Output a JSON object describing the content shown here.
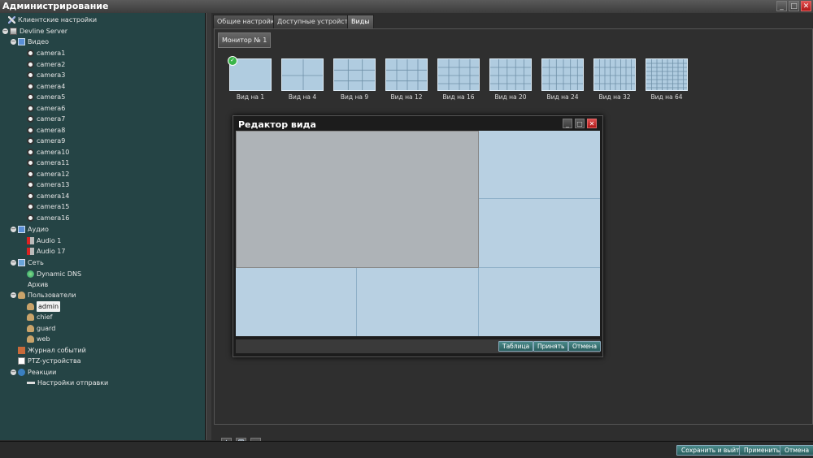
{
  "window": {
    "title": "Администрирование"
  },
  "tree": {
    "client_settings": "Клиентские настройки",
    "server": "Devline Server",
    "video": "Видео",
    "cameras": [
      "camera1",
      "camera2",
      "camera3",
      "camera4",
      "camera5",
      "camera6",
      "camera7",
      "camera8",
      "camera9",
      "camera10",
      "camera11",
      "camera12",
      "camera13",
      "camera14",
      "camera15",
      "camera16"
    ],
    "audio": "Аудио",
    "audio_items": [
      "Audio 1",
      "Audio 17"
    ],
    "network": "Сеть",
    "dns": "Dynamic DNS",
    "archive": "Архив",
    "users": "Пользователи",
    "user_items": [
      "admin",
      "chief",
      "guard",
      "web"
    ],
    "selected_user": "admin",
    "event_log": "Журнал событий",
    "ptz": "PTZ-устройства",
    "reactions": "Реакции",
    "send_settings": "Настройки отправки"
  },
  "tabs": [
    {
      "label": "Общие настройки",
      "active": false
    },
    {
      "label": "Доступные устройства",
      "active": false
    },
    {
      "label": "Виды",
      "active": true
    }
  ],
  "monitor_tab": "Монитор № 1",
  "presets": [
    {
      "label": "Вид на 1",
      "cols": 1,
      "rows": 1,
      "checked": true
    },
    {
      "label": "Вид на 4",
      "cols": 2,
      "rows": 2
    },
    {
      "label": "Вид на 9",
      "cols": 3,
      "rows": 3
    },
    {
      "label": "Вид на 12",
      "cols": 4,
      "rows": 3
    },
    {
      "label": "Вид на 16",
      "cols": 4,
      "rows": 4
    },
    {
      "label": "Вид на 20",
      "cols": 5,
      "rows": 4
    },
    {
      "label": "Вид на 24",
      "cols": 6,
      "rows": 4
    },
    {
      "label": "Вид на 32",
      "cols": 8,
      "rows": 4
    },
    {
      "label": "Вид на 64",
      "cols": 8,
      "rows": 8
    }
  ],
  "editor": {
    "title": "Редактор вида",
    "buttons": {
      "table": "Таблица",
      "apply": "Принять",
      "cancel": "Отмена"
    }
  },
  "footer": {
    "save_exit": "Сохранить и выйти",
    "apply": "Применить",
    "cancel": "Отмена"
  },
  "colors": {
    "panel": "#254445",
    "accent": "#3a7a7a",
    "cell": "#b8d0e2",
    "selected_cell": "#aeb3b7"
  },
  "icons": {
    "add": "plus-icon",
    "delete": "trash-icon",
    "copy": "clipboard-icon"
  }
}
